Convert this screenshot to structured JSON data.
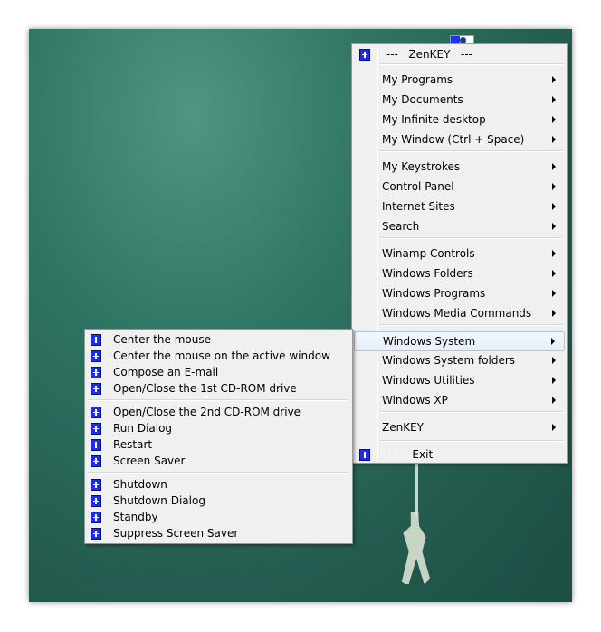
{
  "main_menu": {
    "header": "---   ZenKEY   ---",
    "groups": [
      [
        "My Programs",
        "My Documents",
        "My Infinite desktop",
        "My Window (Ctrl + Space)"
      ],
      [
        "My Keystrokes",
        "Control Panel",
        "Internet Sites",
        "Search"
      ],
      [
        "Winamp Controls",
        "Windows Folders",
        "Windows Programs",
        "Windows Media Commands"
      ],
      [
        "Windows System",
        "Windows System folders",
        "Windows Utilities",
        "Windows XP"
      ],
      [
        "ZenKEY"
      ]
    ],
    "highlighted": "Windows System",
    "exit": "---   Exit   ---"
  },
  "submenu": {
    "groups": [
      [
        "Center the mouse",
        "Center the mouse on the active window",
        "Compose an E-mail",
        "Open/Close the 1st CD-ROM drive"
      ],
      [
        "Open/Close the 2nd CD-ROM drive",
        "Run Dialog",
        "Restart",
        "Screen Saver"
      ],
      [
        "Shutdown",
        "Shutdown Dialog",
        "Standby",
        "Suppress Screen Saver"
      ]
    ]
  }
}
